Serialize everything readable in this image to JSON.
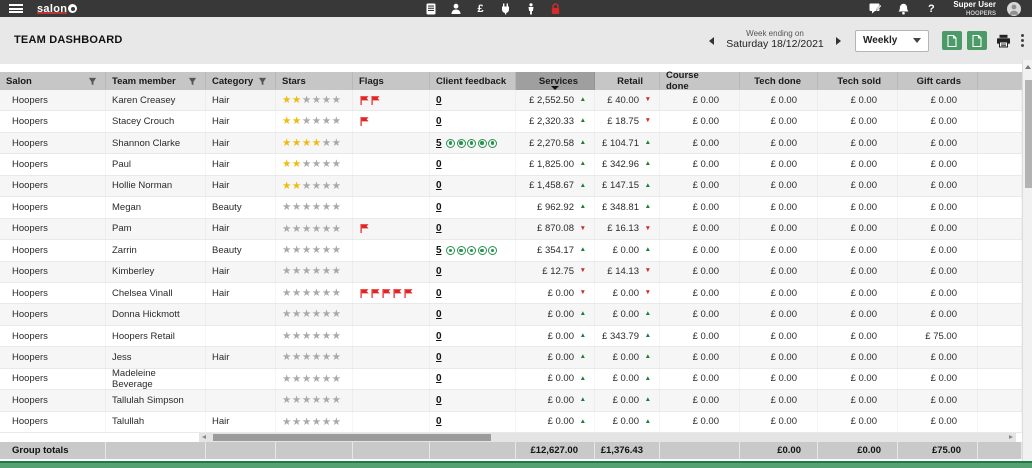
{
  "topbar": {
    "logo_text": "salon",
    "user_name": "Super User",
    "user_location": "HOOPERS"
  },
  "header": {
    "title": "TEAM DASHBOARD",
    "week_prefix": "Week ending on",
    "week_date": "Saturday 18/12/2021",
    "period": "Weekly"
  },
  "icons": {
    "topbar_left": [
      "menu",
      "appointments-book",
      "clients",
      "till-pound",
      "marketing-plug",
      "staff-person",
      "lock"
    ],
    "topbar_right": [
      "sms-message",
      "notifications-bell",
      "help",
      "avatar"
    ],
    "header_controls": [
      "prev-week",
      "next-week",
      "excel-export",
      "csv-export",
      "print",
      "more-options"
    ],
    "table": [
      "filter-funnel",
      "sort-desc",
      "star",
      "flag",
      "feedback-badge",
      "trend-up",
      "trend-down"
    ]
  },
  "colors": {
    "topbar_bg": "#383838",
    "header_bg": "#e8e8e8",
    "accent_green": "#4c9a67",
    "flag_red": "#e32222",
    "star_gold": "#eebc11",
    "trend_up": "#1c7c33",
    "trend_down": "#cc2a2a",
    "footer_green": "#55a172"
  },
  "table": {
    "sorted_column": "Services",
    "sort_direction": "desc",
    "columns": [
      {
        "label": "Salon",
        "filter": true
      },
      {
        "label": "Team member",
        "filter": true
      },
      {
        "label": "Category",
        "filter": true
      },
      {
        "label": "Stars",
        "filter": false
      },
      {
        "label": "Flags",
        "filter": false
      },
      {
        "label": "Client feedback",
        "filter": false
      },
      {
        "label": "Services",
        "filter": false
      },
      {
        "label": "Retail",
        "filter": false
      },
      {
        "label": "Course done",
        "filter": false
      },
      {
        "label": "Tech done",
        "filter": false
      },
      {
        "label": "Tech sold",
        "filter": false
      },
      {
        "label": "Gift cards",
        "filter": false
      }
    ],
    "stars_max": 6,
    "rows": [
      {
        "salon": "Hoopers",
        "member": "Karen Creasey",
        "category": "Hair",
        "stars": 2,
        "flags": 2,
        "feedback": "0",
        "badges": 0,
        "services": "£ 2,552.50",
        "services_trend": "up",
        "retail": "£ 40.00",
        "retail_trend": "down",
        "course": "£ 0.00",
        "tech_done": "£ 0.00",
        "tech_sold": "£ 0.00",
        "gift_cards": "£ 0.00"
      },
      {
        "salon": "Hoopers",
        "member": "Stacey Crouch",
        "category": "Hair",
        "stars": 2,
        "flags": 1,
        "feedback": "0",
        "badges": 0,
        "services": "£ 2,320.33",
        "services_trend": "up",
        "retail": "£ 18.75",
        "retail_trend": "down",
        "course": "£ 0.00",
        "tech_done": "£ 0.00",
        "tech_sold": "£ 0.00",
        "gift_cards": "£ 0.00"
      },
      {
        "salon": "Hoopers",
        "member": "Shannon Clarke",
        "category": "Hair",
        "stars": 4,
        "flags": 0,
        "feedback": "5",
        "badges": 5,
        "services": "£ 2,270.58",
        "services_trend": "up",
        "retail": "£ 104.71",
        "retail_trend": "up",
        "course": "£ 0.00",
        "tech_done": "£ 0.00",
        "tech_sold": "£ 0.00",
        "gift_cards": "£ 0.00"
      },
      {
        "salon": "Hoopers",
        "member": "Paul",
        "category": "Hair",
        "stars": 2,
        "flags": 0,
        "feedback": "0",
        "badges": 0,
        "services": "£ 1,825.00",
        "services_trend": "up",
        "retail": "£ 342.96",
        "retail_trend": "up",
        "course": "£ 0.00",
        "tech_done": "£ 0.00",
        "tech_sold": "£ 0.00",
        "gift_cards": "£ 0.00"
      },
      {
        "salon": "Hoopers",
        "member": "Hollie Norman",
        "category": "Hair",
        "stars": 2,
        "flags": 0,
        "feedback": "0",
        "badges": 0,
        "services": "£ 1,458.67",
        "services_trend": "up",
        "retail": "£ 147.15",
        "retail_trend": "up",
        "course": "£ 0.00",
        "tech_done": "£ 0.00",
        "tech_sold": "£ 0.00",
        "gift_cards": "£ 0.00"
      },
      {
        "salon": "Hoopers",
        "member": "Megan",
        "category": "Beauty",
        "stars": 0,
        "flags": 0,
        "feedback": "0",
        "badges": 0,
        "services": "£ 962.92",
        "services_trend": "up",
        "retail": "£ 348.81",
        "retail_trend": "up",
        "course": "£ 0.00",
        "tech_done": "£ 0.00",
        "tech_sold": "£ 0.00",
        "gift_cards": "£ 0.00"
      },
      {
        "salon": "Hoopers",
        "member": "Pam",
        "category": "Hair",
        "stars": 0,
        "flags": 1,
        "feedback": "0",
        "badges": 0,
        "services": "£ 870.08",
        "services_trend": "down",
        "retail": "£ 16.13",
        "retail_trend": "down",
        "course": "£ 0.00",
        "tech_done": "£ 0.00",
        "tech_sold": "£ 0.00",
        "gift_cards": "£ 0.00"
      },
      {
        "salon": "Hoopers",
        "member": "Zarrin",
        "category": "Beauty",
        "stars": 0,
        "flags": 0,
        "feedback": "5",
        "badges": 5,
        "services": "£ 354.17",
        "services_trend": "up",
        "retail": "£ 0.00",
        "retail_trend": "up",
        "course": "£ 0.00",
        "tech_done": "£ 0.00",
        "tech_sold": "£ 0.00",
        "gift_cards": "£ 0.00"
      },
      {
        "salon": "Hoopers",
        "member": "Kimberley",
        "category": "Hair",
        "stars": 0,
        "flags": 0,
        "feedback": "0",
        "badges": 0,
        "services": "£ 12.75",
        "services_trend": "down",
        "retail": "£ 14.13",
        "retail_trend": "down",
        "course": "£ 0.00",
        "tech_done": "£ 0.00",
        "tech_sold": "£ 0.00",
        "gift_cards": "£ 0.00"
      },
      {
        "salon": "Hoopers",
        "member": "Chelsea Vinall",
        "category": "Hair",
        "stars": 0,
        "flags": 5,
        "feedback": "0",
        "badges": 0,
        "services": "£ 0.00",
        "services_trend": "down",
        "retail": "£ 0.00",
        "retail_trend": "down",
        "course": "£ 0.00",
        "tech_done": "£ 0.00",
        "tech_sold": "£ 0.00",
        "gift_cards": "£ 0.00"
      },
      {
        "salon": "Hoopers",
        "member": "Donna Hickmott",
        "category": "",
        "stars": 0,
        "flags": 0,
        "feedback": "0",
        "badges": 0,
        "services": "£ 0.00",
        "services_trend": "up",
        "retail": "£ 0.00",
        "retail_trend": "up",
        "course": "£ 0.00",
        "tech_done": "£ 0.00",
        "tech_sold": "£ 0.00",
        "gift_cards": "£ 0.00"
      },
      {
        "salon": "Hoopers",
        "member": "Hoopers Retail",
        "category": "",
        "stars": 0,
        "flags": 0,
        "feedback": "0",
        "badges": 0,
        "services": "£ 0.00",
        "services_trend": "up",
        "retail": "£ 343.79",
        "retail_trend": "up",
        "course": "£ 0.00",
        "tech_done": "£ 0.00",
        "tech_sold": "£ 0.00",
        "gift_cards": "£ 75.00"
      },
      {
        "salon": "Hoopers",
        "member": "Jess",
        "category": "Hair",
        "stars": 0,
        "flags": 0,
        "feedback": "0",
        "badges": 0,
        "services": "£ 0.00",
        "services_trend": "up",
        "retail": "£ 0.00",
        "retail_trend": "up",
        "course": "£ 0.00",
        "tech_done": "£ 0.00",
        "tech_sold": "£ 0.00",
        "gift_cards": "£ 0.00"
      },
      {
        "salon": "Hoopers",
        "member": "Madeleine Beverage",
        "category": "",
        "stars": 0,
        "flags": 0,
        "feedback": "0",
        "badges": 0,
        "services": "£ 0.00",
        "services_trend": "up",
        "retail": "£ 0.00",
        "retail_trend": "up",
        "course": "£ 0.00",
        "tech_done": "£ 0.00",
        "tech_sold": "£ 0.00",
        "gift_cards": "£ 0.00"
      },
      {
        "salon": "Hoopers",
        "member": "Tallulah Simpson",
        "category": "",
        "stars": 0,
        "flags": 0,
        "feedback": "0",
        "badges": 0,
        "services": "£ 0.00",
        "services_trend": "up",
        "retail": "£ 0.00",
        "retail_trend": "up",
        "course": "£ 0.00",
        "tech_done": "£ 0.00",
        "tech_sold": "£ 0.00",
        "gift_cards": "£ 0.00"
      },
      {
        "salon": "Hoopers",
        "member": "Talullah",
        "category": "Hair",
        "stars": 0,
        "flags": 0,
        "feedback": "0",
        "badges": 0,
        "services": "£ 0.00",
        "services_trend": "up",
        "retail": "£ 0.00",
        "retail_trend": "up",
        "course": "£ 0.00",
        "tech_done": "£ 0.00",
        "tech_sold": "£ 0.00",
        "gift_cards": "£ 0.00"
      }
    ],
    "totals": {
      "label": "Group totals",
      "services": "£12,627.00",
      "retail": "£1,376.43",
      "course": "",
      "tech_done": "£0.00",
      "tech_sold": "£0.00",
      "gift_cards": "£75.00"
    }
  }
}
